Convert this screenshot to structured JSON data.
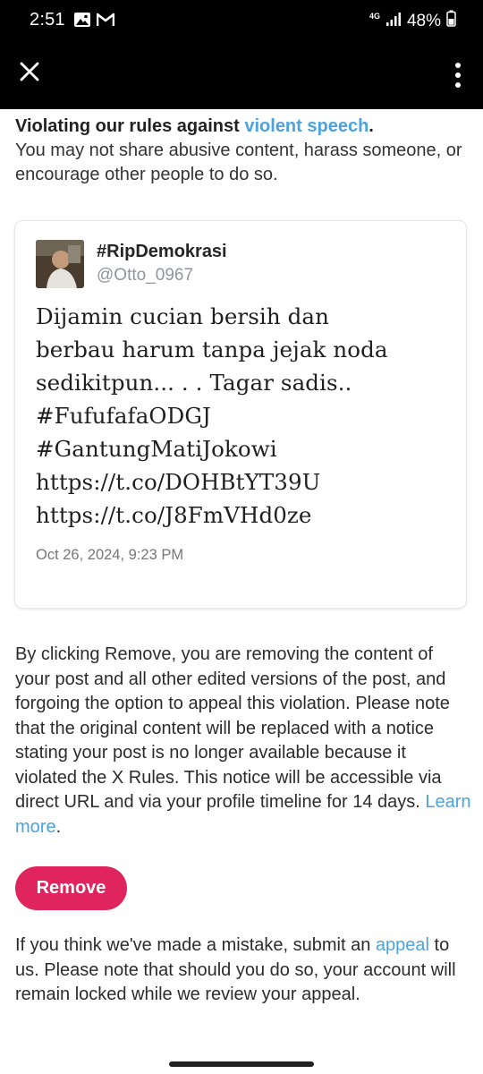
{
  "status_bar": {
    "time": "2:51",
    "network": "4G",
    "battery": "48%",
    "left_icons": [
      "image-icon",
      "gmail-icon"
    ],
    "right_icons": [
      "signal-icon",
      "battery-icon"
    ]
  },
  "app_bar": {
    "close_icon": "close-icon",
    "menu_icon": "more-vertical-icon"
  },
  "rule": {
    "title_prefix": "Violating our rules against ",
    "title_link": "violent speech",
    "title_suffix": ".",
    "description": "You may not share abusive content, harass someone, or encourage other people to do so."
  },
  "post": {
    "display_name": "#RipDemokrasi",
    "handle": "@Otto_0967",
    "text": "Dijamin cucian bersih dan\nberbau harum tanpa jejak noda\nsedikitpun... . . Tagar sadis..\n#FufufafaODGJ\n#GantungMatiJokowi\nhttps://t.co/DOHBtYT39U\nhttps://t.co/J8FmVHd0ze",
    "date": "Oct 26, 2024, 9:23 PM"
  },
  "notice": {
    "text": "By clicking Remove, you are removing the content of your post and all other edited versions of the post, and forgoing the option to appeal this violation. Please note that the original content will be replaced with a notice stating your post is no longer available because it violated the X Rules. This notice will be accessible via direct URL and via your profile timeline for 14 days. ",
    "link": "Learn more",
    "suffix": "."
  },
  "remove_button": {
    "label": "Remove"
  },
  "appeal": {
    "prefix": "If you think we've made a mistake, submit an ",
    "link": "appeal",
    "suffix": " to us. Please note that should you do so, your account will remain locked while we review your appeal."
  },
  "colors": {
    "link": "#4aa3df",
    "remove_button": "#e0245e",
    "bars": "#000000"
  }
}
